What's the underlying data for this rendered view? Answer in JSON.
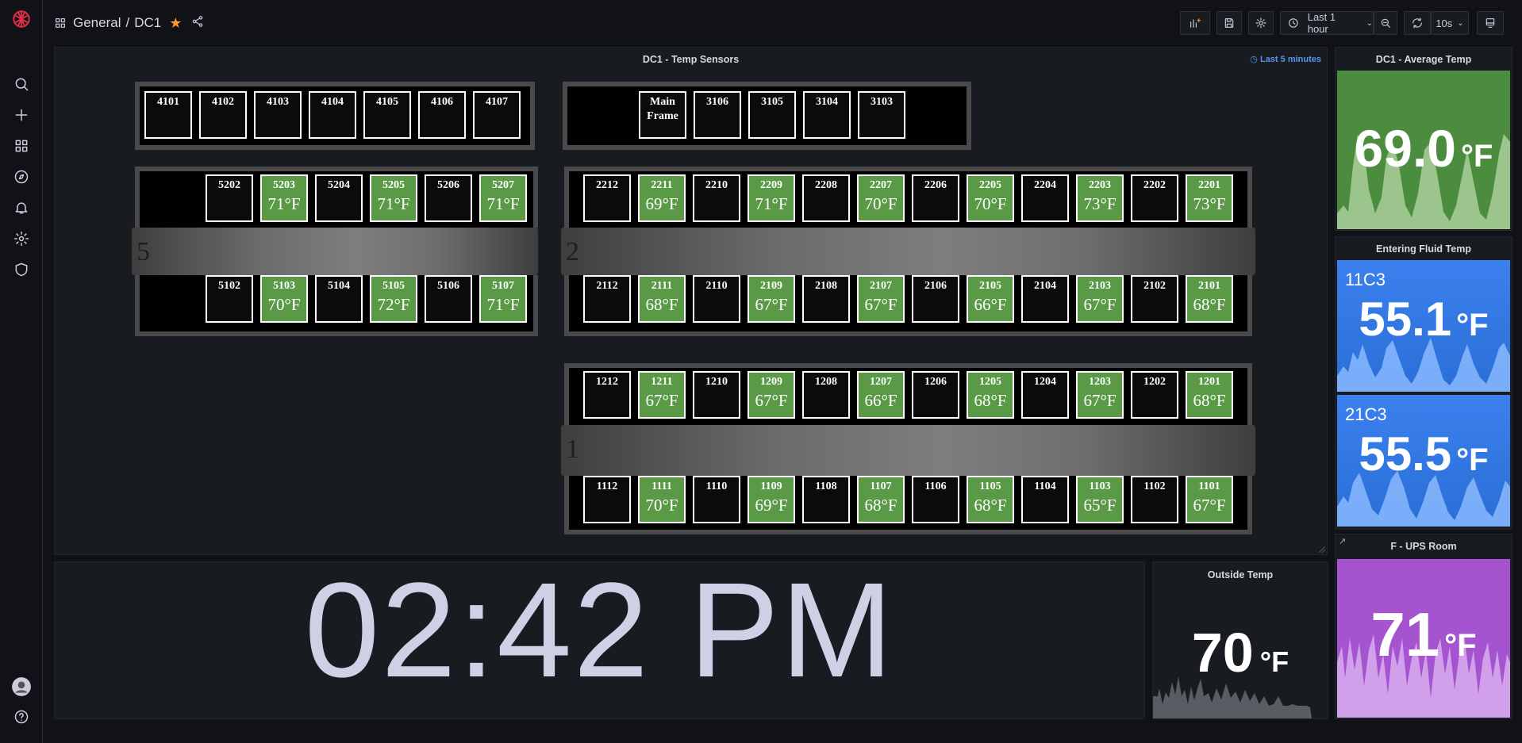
{
  "breadcrumb": {
    "folder": "General",
    "separator": "/",
    "dashboard": "DC1"
  },
  "toolbar": {
    "time_range": "Last 1 hour",
    "refresh": "10s"
  },
  "panels": {
    "sensors": {
      "title": "DC1 - Temp Sensors",
      "time_override": "Last 5 minutes"
    },
    "avg": {
      "title": "DC1 - Average Temp",
      "value": "69.0",
      "unit": "°F",
      "color": "#56a64b"
    },
    "fluid": {
      "title": "Entering Fluid Temp",
      "a_label": "11C3",
      "a_value": "55.1",
      "b_label": "21C3",
      "b_value": "55.5",
      "unit": "°F",
      "color": "#3274d9"
    },
    "ups": {
      "title": "F - UPS Room",
      "value": "71",
      "unit": "°F",
      "color": "#a352cc"
    },
    "outside": {
      "title": "Outside Temp",
      "value": "70",
      "unit": "°F"
    },
    "clock": {
      "time": "02:42 PM"
    }
  },
  "aisles": {
    "a5": "5",
    "a2": "2",
    "a1": "1"
  },
  "racks": {
    "r41": [
      {
        "num": "4101"
      },
      {
        "num": "4102"
      },
      {
        "num": "4103"
      },
      {
        "num": "4104"
      },
      {
        "num": "4105"
      },
      {
        "num": "4106"
      },
      {
        "num": "4107"
      }
    ],
    "r31": [
      {
        "num": "Main Frame"
      },
      {
        "num": "3106"
      },
      {
        "num": "3105"
      },
      {
        "num": "3104"
      },
      {
        "num": "3103"
      }
    ],
    "r52": [
      {
        "num": "5202"
      },
      {
        "num": "5203",
        "temp": "71°F"
      },
      {
        "num": "5204"
      },
      {
        "num": "5205",
        "temp": "71°F"
      },
      {
        "num": "5206"
      },
      {
        "num": "5207",
        "temp": "71°F"
      }
    ],
    "r51": [
      {
        "num": "5102"
      },
      {
        "num": "5103",
        "temp": "70°F"
      },
      {
        "num": "5104"
      },
      {
        "num": "5105",
        "temp": "72°F"
      },
      {
        "num": "5106"
      },
      {
        "num": "5107",
        "temp": "71°F"
      }
    ],
    "r22": [
      {
        "num": "2212"
      },
      {
        "num": "2211",
        "temp": "69°F"
      },
      {
        "num": "2210"
      },
      {
        "num": "2209",
        "temp": "71°F"
      },
      {
        "num": "2208"
      },
      {
        "num": "2207",
        "temp": "70°F"
      },
      {
        "num": "2206"
      },
      {
        "num": "2205",
        "temp": "70°F"
      },
      {
        "num": "2204"
      },
      {
        "num": "2203",
        "temp": "73°F"
      },
      {
        "num": "2202"
      },
      {
        "num": "2201",
        "temp": "73°F"
      }
    ],
    "r21": [
      {
        "num": "2112"
      },
      {
        "num": "2111",
        "temp": "68°F"
      },
      {
        "num": "2110"
      },
      {
        "num": "2109",
        "temp": "67°F"
      },
      {
        "num": "2108"
      },
      {
        "num": "2107",
        "temp": "67°F"
      },
      {
        "num": "2106"
      },
      {
        "num": "2105",
        "temp": "66°F"
      },
      {
        "num": "2104"
      },
      {
        "num": "2103",
        "temp": "67°F"
      },
      {
        "num": "2102"
      },
      {
        "num": "2101",
        "temp": "68°F"
      }
    ],
    "r12": [
      {
        "num": "1212"
      },
      {
        "num": "1211",
        "temp": "67°F"
      },
      {
        "num": "1210"
      },
      {
        "num": "1209",
        "temp": "67°F"
      },
      {
        "num": "1208"
      },
      {
        "num": "1207",
        "temp": "66°F"
      },
      {
        "num": "1206"
      },
      {
        "num": "1205",
        "temp": "68°F"
      },
      {
        "num": "1204"
      },
      {
        "num": "1203",
        "temp": "67°F"
      },
      {
        "num": "1202"
      },
      {
        "num": "1201",
        "temp": "68°F"
      }
    ],
    "r11": [
      {
        "num": "1112"
      },
      {
        "num": "1111",
        "temp": "70°F"
      },
      {
        "num": "1110"
      },
      {
        "num": "1109",
        "temp": "69°F"
      },
      {
        "num": "1108"
      },
      {
        "num": "1107",
        "temp": "68°F"
      },
      {
        "num": "1106"
      },
      {
        "num": "1105",
        "temp": "68°F"
      },
      {
        "num": "1104"
      },
      {
        "num": "1103",
        "temp": "65°F"
      },
      {
        "num": "1102"
      },
      {
        "num": "1101",
        "temp": "67°F"
      }
    ]
  }
}
